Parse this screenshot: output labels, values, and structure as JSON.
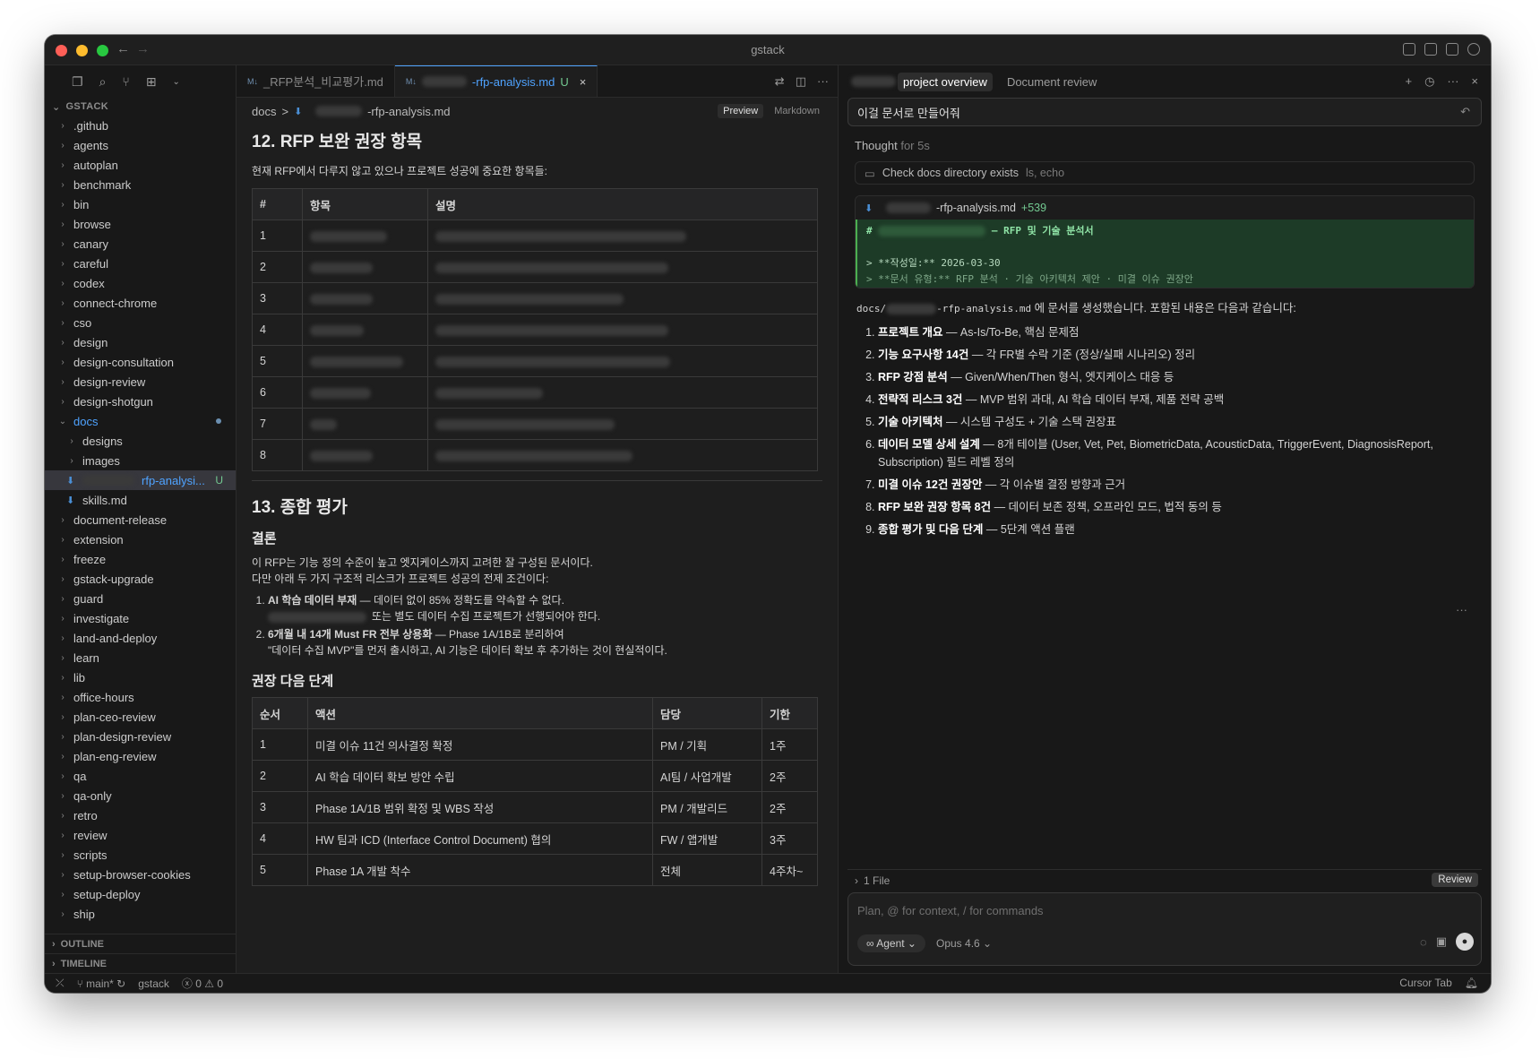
{
  "window": {
    "title": "gstack"
  },
  "sidebar": {
    "section": "GSTACK",
    "items": [
      {
        "label": ".github"
      },
      {
        "label": "agents"
      },
      {
        "label": "autoplan"
      },
      {
        "label": "benchmark"
      },
      {
        "label": "bin"
      },
      {
        "label": "browse"
      },
      {
        "label": "canary"
      },
      {
        "label": "careful"
      },
      {
        "label": "codex"
      },
      {
        "label": "connect-chrome"
      },
      {
        "label": "cso"
      },
      {
        "label": "design"
      },
      {
        "label": "design-consultation"
      },
      {
        "label": "design-review"
      },
      {
        "label": "design-shotgun"
      }
    ],
    "docs": {
      "label": "docs",
      "children": [
        "designs",
        "images"
      ],
      "selected_file": "rfp-analysi...",
      "selected_badge": "U",
      "skills": "skills.md"
    },
    "items2": [
      {
        "label": "document-release"
      },
      {
        "label": "extension"
      },
      {
        "label": "freeze"
      },
      {
        "label": "gstack-upgrade"
      },
      {
        "label": "guard"
      },
      {
        "label": "investigate"
      },
      {
        "label": "land-and-deploy"
      },
      {
        "label": "learn"
      },
      {
        "label": "lib"
      },
      {
        "label": "office-hours"
      },
      {
        "label": "plan-ceo-review"
      },
      {
        "label": "plan-design-review"
      },
      {
        "label": "plan-eng-review"
      },
      {
        "label": "qa"
      },
      {
        "label": "qa-only"
      },
      {
        "label": "retro"
      },
      {
        "label": "review"
      },
      {
        "label": "scripts"
      },
      {
        "label": "setup-browser-cookies"
      },
      {
        "label": "setup-deploy"
      },
      {
        "label": "ship"
      }
    ],
    "outline": "OUTLINE",
    "timeline": "TIMELINE"
  },
  "editor": {
    "tabs": [
      {
        "label": "_RFP분석_비교평가.md"
      },
      {
        "label": "-rfp-analysis.md",
        "badge": "U"
      }
    ],
    "breadcrumb": {
      "root": "docs",
      "sep": ">",
      "file": "-rfp-analysis.md"
    },
    "view": {
      "preview": "Preview",
      "markdown": "Markdown"
    },
    "sec12": {
      "title": "12. RFP 보완 권장 항목",
      "intro": "현재 RFP에서 다루지 않고 있으나 프로젝트 성공에 중요한 항목들:"
    },
    "table1": {
      "headers": [
        "#",
        "항목",
        "설명"
      ],
      "rows": [
        "1",
        "2",
        "3",
        "4",
        "5",
        "6",
        "7",
        "8"
      ]
    },
    "sec13": {
      "title": "13. 종합 평가",
      "conclusion_title": "결론",
      "p1": "이 RFP는 기능 정의 수준이 높고 엣지케이스까지 고려한 잘 구성된 문서이다.",
      "p2": "다만 아래 두 가지 구조적 리스크가 프로젝트 성공의 전제 조건이다:",
      "li1_bold": "AI 학습 데이터 부재",
      "li1_text": " — 데이터 없이 85% 정확도를 약속할 수 없다.",
      "li1_sub": "또는 별도 데이터 수집 프로젝트가 선행되어야 한다.",
      "li2_bold": "6개월 내 14개 Must FR 전부 상용화",
      "li2_text": " — Phase 1A/1B로 분리하여",
      "li2_sub": "\"데이터 수집 MVP\"를 먼저 출시하고, AI 기능은 데이터 확보 후 추가하는 것이 현실적이다.",
      "next_title": "권장 다음 단계"
    },
    "table2": {
      "headers": [
        "순서",
        "액션",
        "담당",
        "기한"
      ],
      "rows": [
        [
          "1",
          "미결 이슈 11건 의사결정 확정",
          "PM / 기획",
          "1주"
        ],
        [
          "2",
          "AI 학습 데이터 확보 방안 수립",
          "AI팀 / 사업개발",
          "2주"
        ],
        [
          "3",
          "Phase 1A/1B 범위 확정 및 WBS 작성",
          "PM / 개발리드",
          "2주"
        ],
        [
          "4",
          "HW 팀과 ICD (Interface Control Document) 협의",
          "FW / 앱개발",
          "3주"
        ],
        [
          "5",
          "Phase 1A 개발 착수",
          "전체",
          "4주차~"
        ]
      ]
    }
  },
  "chat": {
    "tabs": [
      "project overview",
      "Document review"
    ],
    "user_message": "이걸 문서로 만들어줘",
    "thought": "Thought",
    "thought_dur": "for 5s",
    "tool": {
      "label": "Check docs directory exists",
      "sub": "ls, echo"
    },
    "diff": {
      "file": "-rfp-analysis.md",
      "added": "+539",
      "line1_prefix": "#",
      "line1": "— RFP 및 기술 분석서",
      "line2": "> **작성일:** 2026-03-30",
      "line3": "> **문서 유형:** RFP 분석 · 기술 아키텍처 제안 · 미결 이슈 권장안"
    },
    "answer_prefix": "docs/",
    "answer_file": "-rfp-analysis.md",
    "answer_suffix": " 에 문서를 생성했습니다. 포함된 내용은 다음과 같습니다:",
    "list": [
      {
        "b": "프로젝트 개요",
        "t": " — As-Is/To-Be, 핵심 문제점"
      },
      {
        "b": "기능 요구사항 14건",
        "t": " — 각 FR별 수락 기준 (정상/실패 시나리오) 정리"
      },
      {
        "b": "RFP 강점 분석",
        "t": " — Given/When/Then 형식, 엣지케이스 대응 등"
      },
      {
        "b": "전략적 리스크 3건",
        "t": " — MVP 범위 과대, AI 학습 데이터 부재, 제품 전략 공백"
      },
      {
        "b": "기술 아키텍처",
        "t": " — 시스템 구성도 + 기술 스택 권장표"
      },
      {
        "b": "데이터 모델 상세 설계",
        "t": " — 8개 테이블 (User, Vet, Pet, BiometricData, AcousticData, TriggerEvent, DiagnosisReport, Subscription) 필드 레벨 정의"
      },
      {
        "b": "미결 이슈 12건 권장안",
        "t": " — 각 이슈별 결정 방향과 근거"
      },
      {
        "b": "RFP 보완 권장 항목 8건",
        "t": " — 데이터 보존 정책, 오프라인 모드, 법적 동의 등"
      },
      {
        "b": "종합 평가 및 다음 단계",
        "t": " — 5단계 액션 플랜"
      }
    ],
    "files": "1 File",
    "review": "Review",
    "composer_placeholder": "Plan, @ for context, / for commands",
    "agent": "Agent",
    "model": "Opus 4.6"
  },
  "status": {
    "branch": "main*",
    "repo": "gstack",
    "errors": "0",
    "warnings": "0",
    "cursor_tab": "Cursor Tab"
  }
}
